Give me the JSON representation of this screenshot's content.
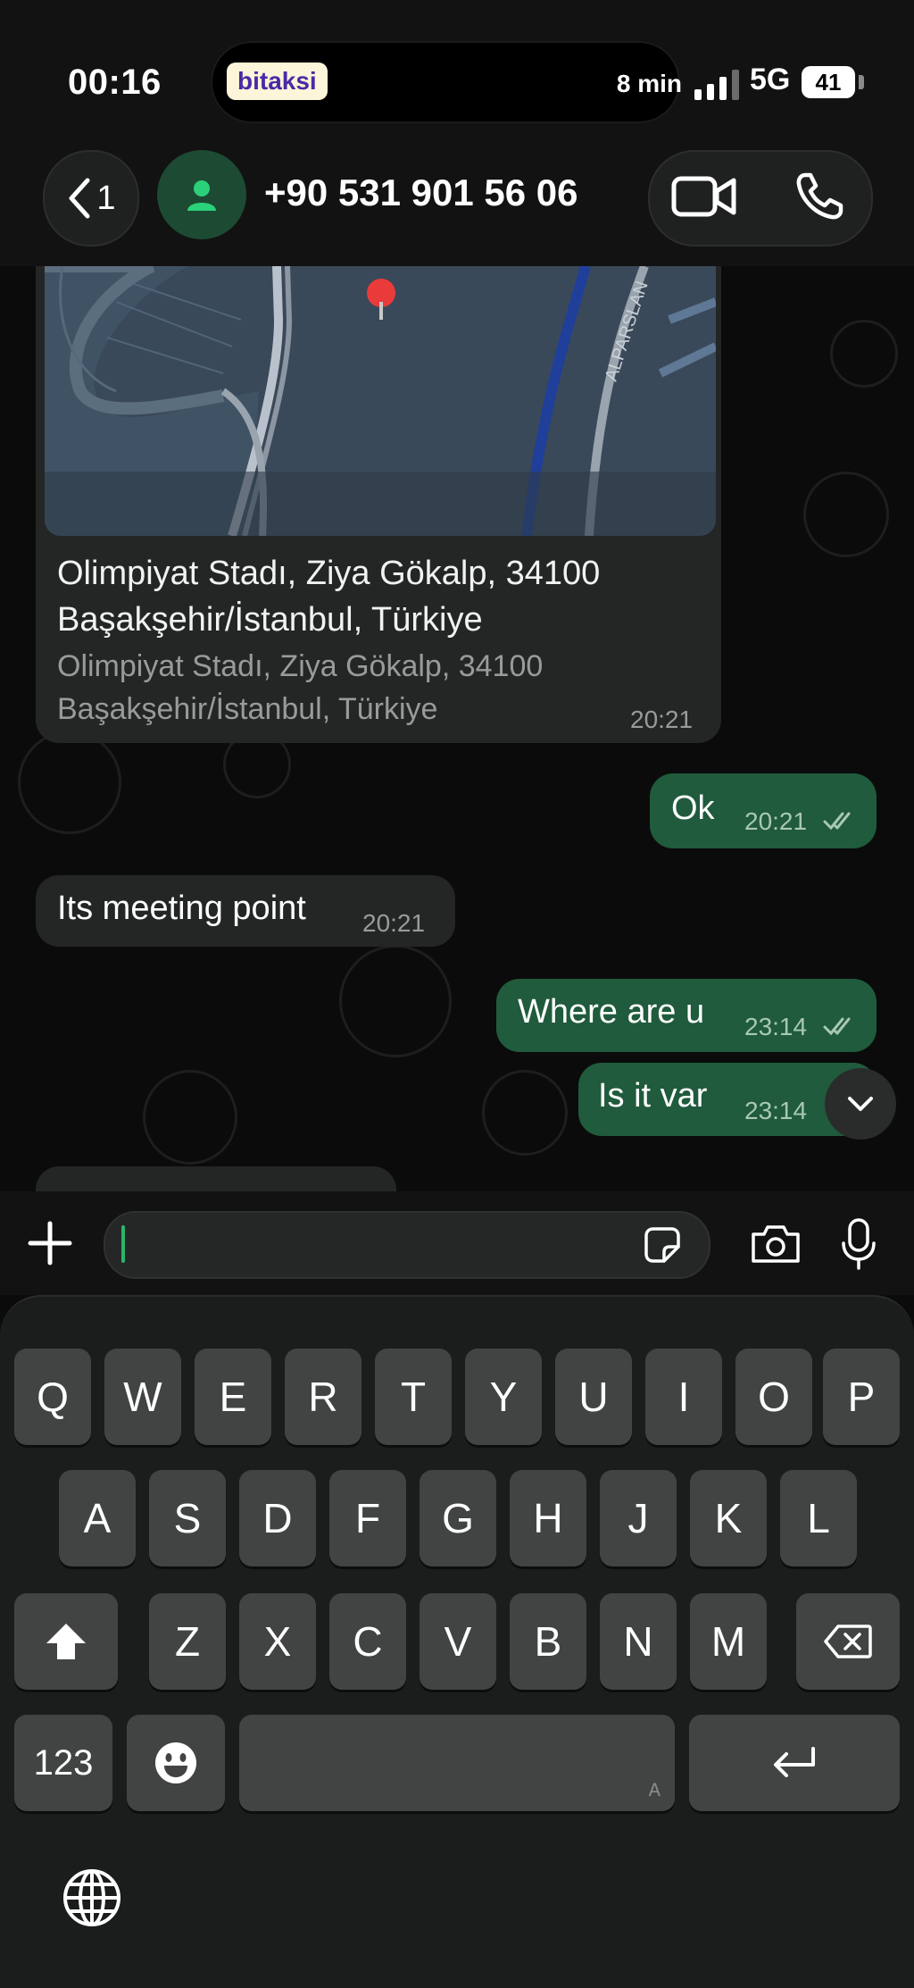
{
  "status_bar": {
    "time": "00:16",
    "app_pill": "bitaksi",
    "eta": "8 min",
    "network": "5G",
    "battery": "41"
  },
  "header": {
    "back_count": "1",
    "contact_name": "+90 531 901 56 06"
  },
  "map": {
    "street_label": "ALPARSLAN"
  },
  "location_message": {
    "title": "Olimpiyat Stadı, Ziya Gökalp, 34100 Başakşehir/İstanbul, Türkiye",
    "subtitle": "Olimpiyat Stadı, Ziya Gökalp, 34100 Başakşehir/İstanbul, Türkiye",
    "time": "20:21"
  },
  "messages": [
    {
      "direction": "out",
      "text": "Ok",
      "time": "20:21"
    },
    {
      "direction": "in",
      "text": "Its meeting point",
      "time": "20:21"
    },
    {
      "direction": "out",
      "text": "Where are u",
      "time": "23:14"
    },
    {
      "direction": "out",
      "text": "Is it var",
      "time": "23:14"
    }
  ],
  "keyboard": {
    "row1": [
      "Q",
      "W",
      "E",
      "R",
      "T",
      "Y",
      "U",
      "I",
      "O",
      "P"
    ],
    "row2": [
      "A",
      "S",
      "D",
      "F",
      "G",
      "H",
      "J",
      "K",
      "L"
    ],
    "row3": [
      "Z",
      "X",
      "C",
      "V",
      "B",
      "N",
      "M"
    ],
    "numbers_key": "123",
    "space_hint": "A"
  },
  "colors": {
    "outgoing_bubble": "#1f5b3c",
    "incoming_bubble": "#242626",
    "accent": "#2bb56b"
  }
}
